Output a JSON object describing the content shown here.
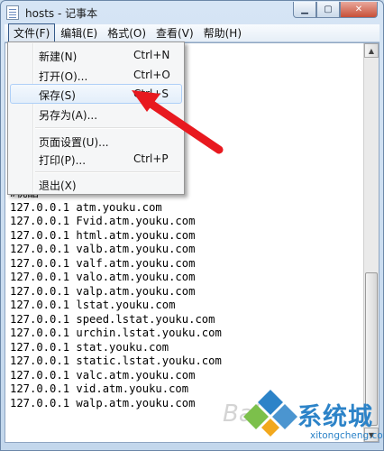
{
  "window": {
    "title": "hosts - 记事本"
  },
  "caption_buttons": {
    "minimize_icon": "minimize-icon",
    "maximize_icon": "maximize-icon",
    "close_icon": "close-icon"
  },
  "menubar": [
    {
      "label": "文件(F)",
      "active": true
    },
    {
      "label": "编辑(E)"
    },
    {
      "label": "格式(O)"
    },
    {
      "label": "查看(V)"
    },
    {
      "label": "帮助(H)"
    }
  ],
  "file_menu": {
    "new": {
      "label": "新建(N)",
      "shortcut": "Ctrl+N"
    },
    "open": {
      "label": "打开(O)...",
      "shortcut": "Ctrl+O"
    },
    "save": {
      "label": "保存(S)",
      "shortcut": "Ctrl+S"
    },
    "save_as": {
      "label": "另存为(A)..."
    },
    "page_setup": {
      "label": "页面设置(U)..."
    },
    "print": {
      "label": "打印(P)...",
      "shortcut": "Ctrl+P"
    },
    "exit": {
      "label": "退出(X)"
    }
  },
  "editor": {
    "lines": [
      "              dobe.com",
      "",
      "                 m",
      "                .com",
      "               obe.com",
      "               .com",
      "               obe.com",
      "               0.adobe.com",
      "               dobe.com",
      "",
      "#优酷",
      "127.0.0.1 atm.youku.com",
      "127.0.0.1 Fvid.atm.youku.com",
      "127.0.0.1 html.atm.youku.com",
      "127.0.0.1 valb.atm.youku.com",
      "127.0.0.1 valf.atm.youku.com",
      "127.0.0.1 valo.atm.youku.com",
      "127.0.0.1 valp.atm.youku.com",
      "127.0.0.1 lstat.youku.com",
      "127.0.0.1 speed.lstat.youku.com",
      "127.0.0.1 urchin.lstat.youku.com",
      "127.0.0.1 stat.youku.com",
      "127.0.0.1 static.lstat.youku.com",
      "127.0.0.1 valc.atm.youku.com",
      "127.0.0.1 vid.atm.youku.com",
      "127.0.0.1 walp.atm.youku.com"
    ]
  },
  "watermark": {
    "brand": "系统城",
    "url": "xitongcheng.com",
    "bg_text": "Bai"
  },
  "colors": {
    "arrow": "#e8191f",
    "accent": "#2c83c8"
  }
}
